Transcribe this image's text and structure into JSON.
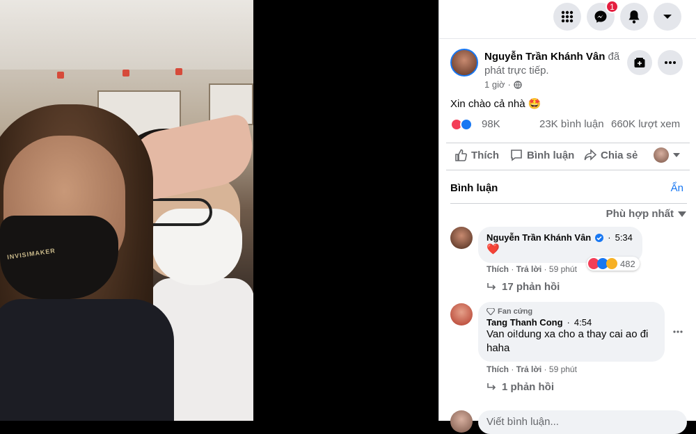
{
  "topbar": {
    "messenger_badge": "1"
  },
  "post": {
    "author": "Nguyễn Trần Khánh Vân",
    "author_tail": "đã phát trực tiếp.",
    "time": "1 giờ",
    "text": "Xin chào cả nhà",
    "emoji": "🤩",
    "reactions_count": "98K",
    "comments_count": "23K bình luận",
    "views_count": "660K lượt xem"
  },
  "actions": {
    "like": "Thích",
    "comment": "Bình luận",
    "share": "Chia sẻ"
  },
  "comments_section": {
    "title": "Bình luận",
    "hide": "Ẩn",
    "sort": "Phù hợp nhất",
    "input_placeholder": "Viết bình luận..."
  },
  "comments": [
    {
      "name": "Nguyễn Trần Khánh Vân",
      "time": "5:34",
      "text": "❤️",
      "like": "Thích",
      "reply": "Trả lời",
      "ago": "59 phút",
      "reactions": "482",
      "replies": "17 phản hồi"
    },
    {
      "badge": "Fan cứng",
      "name": "Tang Thanh Cong",
      "time": "4:54",
      "text": "Van oi!dung xa cho a thay cai ao đi haha",
      "like": "Thích",
      "reply": "Trả lời",
      "ago": "59 phút",
      "replies": "1 phản hồi"
    }
  ],
  "video": {
    "mask_text": "INVISIMAKER"
  },
  "colors": {
    "accent": "#1877f2",
    "badge": "#e41e3f",
    "bubble": "#f0f2f5",
    "secondary_text": "#65676b"
  }
}
